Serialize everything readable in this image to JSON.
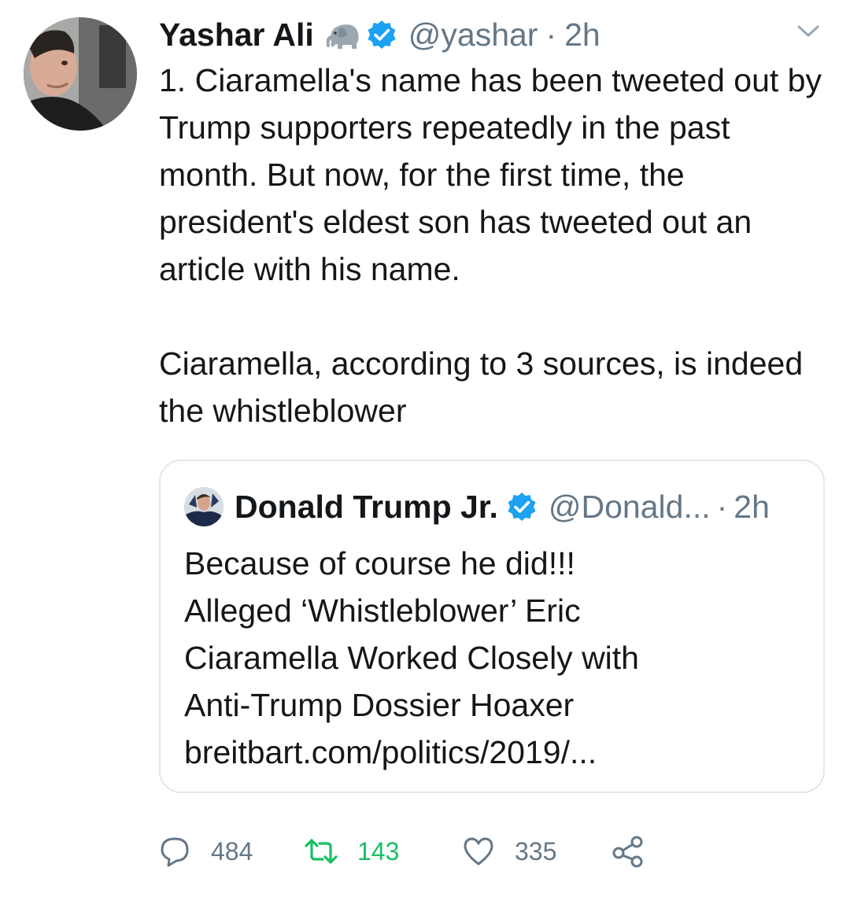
{
  "tweet": {
    "author_name": "Yashar Ali",
    "author_handle": "@yashar",
    "separator": "·",
    "time": "2h",
    "author_emoji": "elephant-icon",
    "paragraphs": [
      "1. Ciaramella's name has been tweeted out by Trump supporters repeatedly in the past month. But now, for the first time, the president's eldest son has tweeted out an article with his name.",
      "Ciaramella, according to 3 sources, is indeed the whistleblower"
    ]
  },
  "quoted": {
    "name": "Donald Trump Jr.",
    "handle": "@Donald...",
    "separator": "·",
    "time": "2h",
    "lines": [
      "Because of course he did!!!",
      "Alleged ‘Whistleblower’ Eric",
      "Ciaramella Worked Closely with",
      "Anti-Trump Dossier Hoaxer",
      "breitbart.com/politics/2019/..."
    ]
  },
  "actions": {
    "replies": "484",
    "retweets": "143",
    "likes": "335"
  },
  "colors": {
    "verified": "#1da1f2",
    "secondary_text": "#657786",
    "retweet_active": "#17bf63",
    "border": "#e1e8ed"
  }
}
